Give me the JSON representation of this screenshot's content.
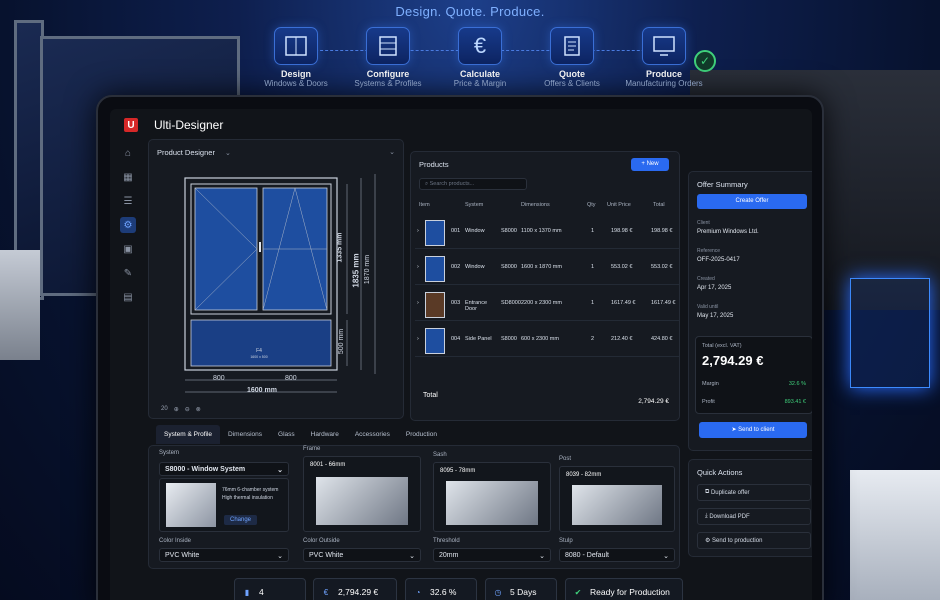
{
  "tagline": "Design. Quote. Produce.",
  "steps": [
    {
      "title": "Design",
      "sub": "Windows & Doors",
      "icon": "window-icon"
    },
    {
      "title": "Configure",
      "sub": "Systems & Profiles",
      "icon": "profile-icon"
    },
    {
      "title": "Calculate",
      "sub": "Price & Margin",
      "icon": "euro-icon"
    },
    {
      "title": "Quote",
      "sub": "Offers & Clients",
      "icon": "document-icon"
    },
    {
      "title": "Produce",
      "sub": "Manufacturing Orders",
      "icon": "monitor-icon"
    }
  ],
  "app": {
    "name": "Ulti-Designer",
    "logo": "U"
  },
  "designer": {
    "title": "Product Designer",
    "dims": {
      "sash_h": "1335 mm",
      "total_h": "1835 mm",
      "outer_h": "1870 mm",
      "bottom_h": "500 mm",
      "left_w": "800",
      "right_w": "800",
      "total_w": "1600 mm"
    },
    "panel_label": "F4",
    "panel_sub": "1600 x 500",
    "zoom": "20"
  },
  "products": {
    "title": "Products",
    "new_label": "New",
    "search_placeholder": "Search products...",
    "headers": [
      "Item",
      "System",
      "Dimensions",
      "Qty",
      "Unit Price",
      "Total"
    ],
    "rows": [
      {
        "no": "001",
        "name": "Window",
        "system": "S8000",
        "dims": "1100 x 1370 mm",
        "qty": "1",
        "unit": "198.98 €",
        "total": "198.98 €"
      },
      {
        "no": "002",
        "name": "Window",
        "system": "S8000",
        "dims": "1600 x 1870 mm",
        "qty": "1",
        "unit": "553.02 €",
        "total": "553.02 €"
      },
      {
        "no": "003",
        "name": "Entrance Door",
        "system": "SD8000",
        "dims": "2200 x 2300 mm",
        "qty": "1",
        "unit": "1617.49 €",
        "total": "1617.49 €"
      },
      {
        "no": "004",
        "name": "Side Panel",
        "system": "S8000",
        "dims": "600 x 2300 mm",
        "qty": "2",
        "unit": "212.40 €",
        "total": "424.80 €"
      }
    ],
    "total_label": "Total",
    "total_value": "2,794.29 €"
  },
  "config": {
    "tabs": [
      "System & Profile",
      "Dimensions",
      "Glass",
      "Hardware",
      "Accessories",
      "Production"
    ],
    "system_label": "System",
    "system_value": "S8000 - Window System",
    "system_desc1": "76mm 6-chamber system",
    "system_desc2": "High thermal insulation",
    "change_label": "Change",
    "frame_label": "Frame",
    "frame_value": "8001 - 66mm",
    "sash_label": "Sash",
    "sash_value": "8095 - 78mm",
    "post_label": "Post",
    "post_value": "8039 - 82mm",
    "color_in_label": "Color Inside",
    "color_in_value": "PVC White",
    "color_out_label": "Color Outside",
    "color_out_value": "PVC White",
    "threshold_label": "Threshold",
    "threshold_value": "20mm",
    "stulp_label": "Stulp",
    "stulp_value": "8080 - Default"
  },
  "offer": {
    "title": "Offer Summary",
    "create_label": "Create Offer",
    "fields": [
      {
        "label": "Client",
        "value": "Premium Windows Ltd."
      },
      {
        "label": "Reference",
        "value": "OFF-2025-0417"
      },
      {
        "label": "Created",
        "value": "Apr 17, 2025"
      },
      {
        "label": "Valid until",
        "value": "May 17, 2025"
      }
    ],
    "total_label": "Total (excl. VAT)",
    "total_value": "2,794.29 €",
    "margin_label": "Margin",
    "margin_value": "32.6 %",
    "profit_label": "Profit",
    "profit_value": "893.41 €",
    "send_label": "Send to client"
  },
  "quick": {
    "title": "Quick Actions",
    "items": [
      "Duplicate offer",
      "Download PDF",
      "Send to production"
    ]
  },
  "kpis": [
    {
      "value": "4",
      "icon": "window-icon"
    },
    {
      "value": "2,794.29 €",
      "icon": "euro-icon"
    },
    {
      "value": "32.6 %",
      "icon": "gauge-icon"
    },
    {
      "value": "5 Days",
      "icon": "clock-icon"
    },
    {
      "value": "Ready for Production",
      "icon": "check-icon"
    }
  ],
  "colors": {
    "accent": "#2a6af0",
    "success": "#3fd07b",
    "brand": "#d62828"
  }
}
